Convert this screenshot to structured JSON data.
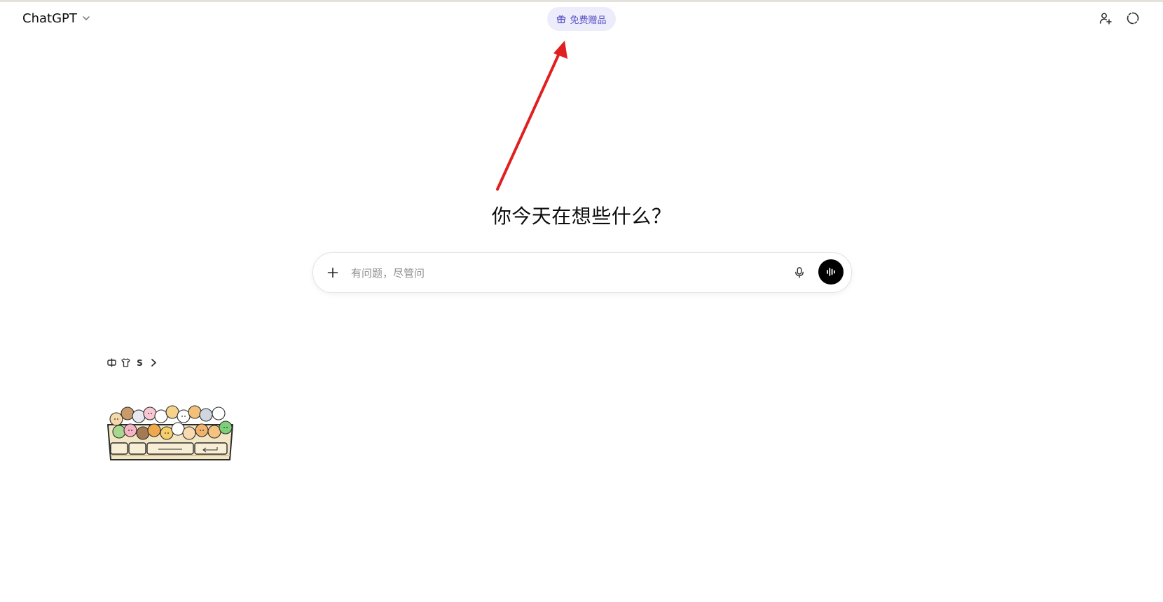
{
  "header": {
    "model_name": "ChatGPT",
    "gift_label": "免费赠品"
  },
  "main": {
    "greeting": "你今天在想些什么？",
    "composer": {
      "placeholder": "有问题，尽管问"
    }
  },
  "sticker_toolbar": {
    "letter_icon": "S"
  },
  "icons": {
    "model_dropdown": "chevron-down-icon",
    "gift": "gift-icon",
    "add_user": "user-plus-icon",
    "temporary_chat": "dashed-circle-icon",
    "attach": "plus-icon",
    "microphone": "microphone-icon",
    "voice_mode": "sound-wave-icon",
    "annotation": "red-arrow-icon"
  },
  "colors": {
    "gift_pill_background": "#ececfb",
    "gift_text": "#5b53c6",
    "voice_button": "#000000",
    "annotation_arrow": "#e02020"
  }
}
